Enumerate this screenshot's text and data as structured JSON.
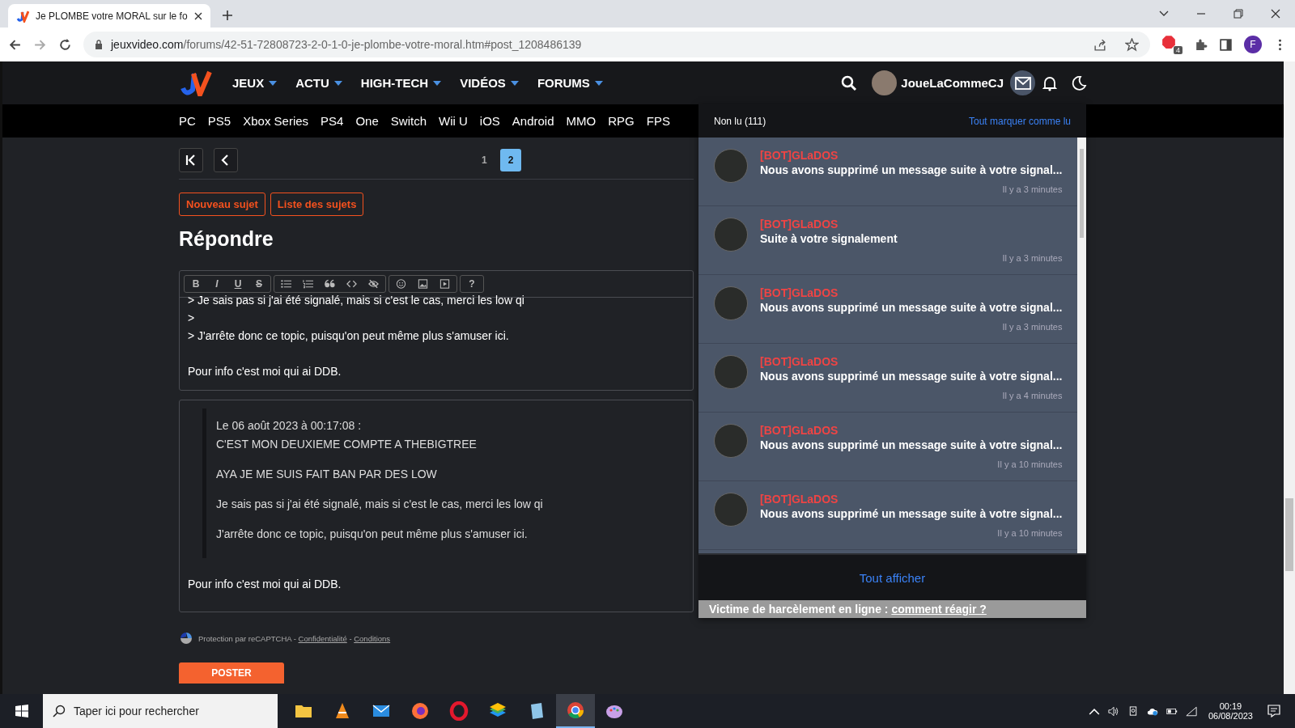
{
  "browser": {
    "tab_title": "Je PLOMBE votre MORAL sur le fo",
    "url_host": "jeuxvideo.com",
    "url_path": "/forums/42-51-72808723-2-0-1-0-je-plombe-votre-moral.htm#post_1208486139",
    "extension_badge": "4",
    "profile_initial": "F"
  },
  "header": {
    "nav": [
      "JEUX",
      "ACTU",
      "HIGH-TECH",
      "VIDÉOS",
      "FORUMS"
    ],
    "username": "JoueLaCommeCJ",
    "messages_open": true,
    "platforms": [
      "PC",
      "PS5",
      "Xbox Series",
      "PS4",
      "One",
      "Switch",
      "Wii U",
      "iOS",
      "Android",
      "MMO",
      "RPG",
      "FPS"
    ]
  },
  "pagination": [
    {
      "label": "1",
      "selected": false
    },
    {
      "label": "2",
      "selected": true
    }
  ],
  "topic_buttons": [
    "Nouveau sujet",
    "Liste des sujets"
  ],
  "heading": "Répondre",
  "editor": {
    "toolbar": [
      [
        {
          "kind": "bold",
          "label": "B"
        },
        {
          "kind": "italic",
          "label": "I"
        },
        {
          "kind": "underline",
          "label": "U"
        },
        {
          "kind": "strike",
          "label": "S"
        }
      ],
      [
        {
          "kind": "bullets"
        },
        {
          "kind": "numbers"
        },
        {
          "kind": "quote"
        },
        {
          "kind": "code"
        },
        {
          "kind": "spoiler"
        }
      ],
      [
        {
          "kind": "smiley"
        },
        {
          "kind": "image"
        },
        {
          "kind": "video"
        }
      ],
      [
        {
          "kind": "help",
          "label": "?"
        }
      ]
    ],
    "quote_lines": [
      "> Je sais pas si j'ai été signalé, mais si c'est le cas, merci les low qi",
      ">",
      "> J'arrête donc ce topic, puisqu'on peut même plus s'amuser ici."
    ],
    "text": "Pour info c'est moi qui ai DDB."
  },
  "preview": {
    "quote_date": "Le 06 août 2023 à 00:17:08 :",
    "quote_lines": [
      "C'EST MON DEUXIEME COMPTE A THEBIGTREE",
      "AYA JE ME SUIS FAIT BAN PAR DES LOW",
      "Je sais pas si j'ai été signalé, mais si c'est le cas, merci les low qi",
      "J'arrête donc ce topic, puisqu'on peut même plus s'amuser ici."
    ],
    "text": "Pour info c'est moi qui ai DDB."
  },
  "recaptcha": {
    "text": "Protection par reCAPTCHA -",
    "privacy": "Confidentialité",
    "separator": "-",
    "terms": "Conditions"
  },
  "submit": "POSTER",
  "notifications": {
    "title": "Non lu (111)",
    "mark_all": "Tout marquer comme lu",
    "items": [
      {
        "author": "[BOT]GLaDOS",
        "message": "Nous avons supprimé un message suite à votre signal...",
        "time": "Il y a 3 minutes"
      },
      {
        "author": "[BOT]GLaDOS",
        "message": "Suite à votre signalement",
        "time": "Il y a 3 minutes"
      },
      {
        "author": "[BOT]GLaDOS",
        "message": "Nous avons supprimé un message suite à votre signal...",
        "time": "Il y a 3 minutes"
      },
      {
        "author": "[BOT]GLaDOS",
        "message": "Nous avons supprimé un message suite à votre signal...",
        "time": "Il y a 4 minutes"
      },
      {
        "author": "[BOT]GLaDOS",
        "message": "Nous avons supprimé un message suite à votre signal...",
        "time": "Il y a 10 minutes"
      },
      {
        "author": "[BOT]GLaDOS",
        "message": "Nous avons supprimé un message suite à votre signal...",
        "time": "Il y a 10 minutes"
      }
    ],
    "show_all": "Tout afficher",
    "banner_text": "Victime de harcèlement en ligne :",
    "banner_link": "comment réagir ?"
  },
  "taskbar": {
    "search_placeholder": "Taper ici pour rechercher",
    "apps": [
      {
        "kind": "folder",
        "active": false
      },
      {
        "kind": "cone",
        "active": false
      },
      {
        "kind": "mail",
        "active": false
      },
      {
        "kind": "firefox",
        "active": false
      },
      {
        "kind": "opera",
        "active": false
      },
      {
        "kind": "stack",
        "active": false
      },
      {
        "kind": "notepad",
        "active": false
      },
      {
        "kind": "chrome",
        "active": true
      },
      {
        "kind": "paint",
        "active": false
      }
    ],
    "time": "00:19",
    "date": "06/08/2023"
  }
}
